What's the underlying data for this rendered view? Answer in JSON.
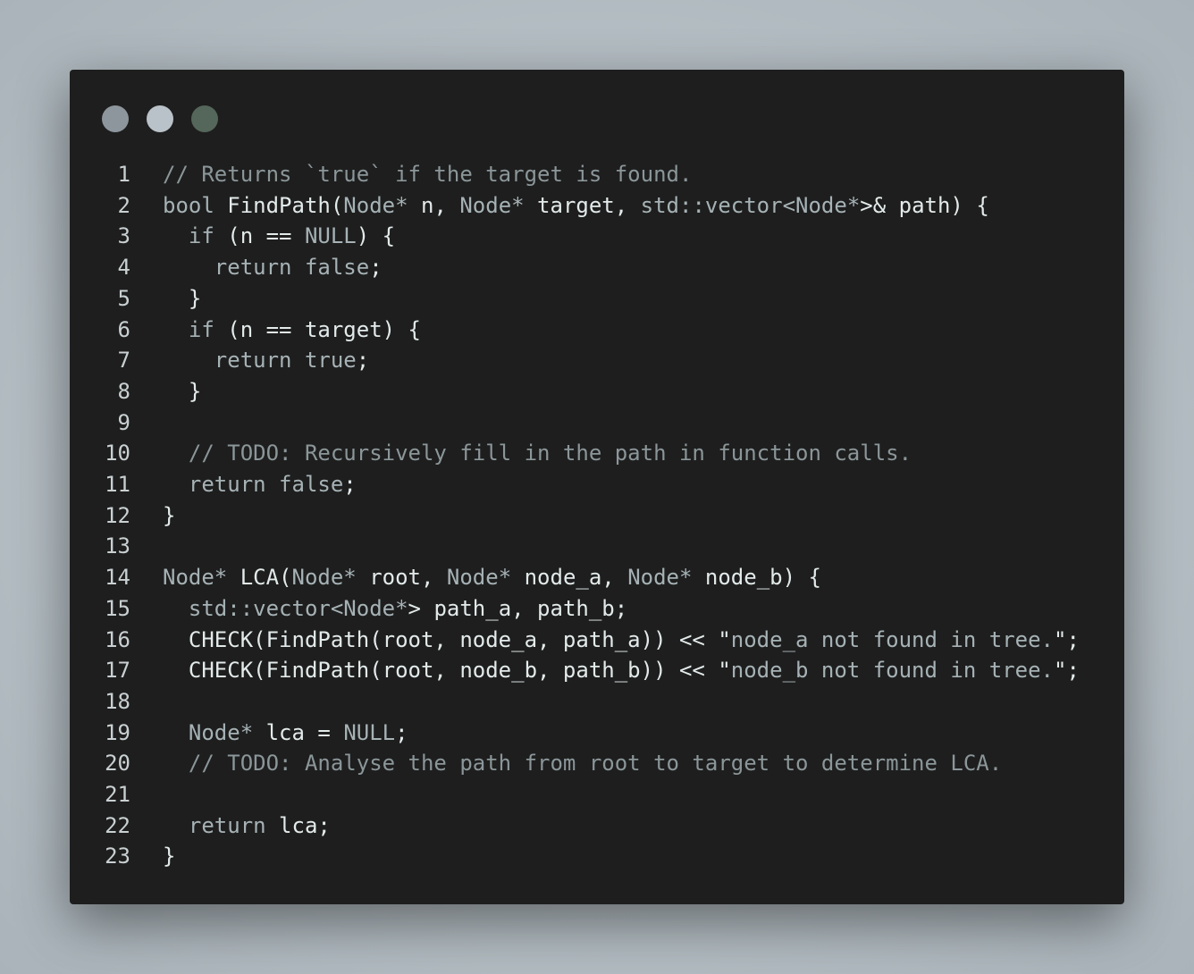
{
  "window_controls": [
    {
      "name": "close",
      "color": "#8d969c"
    },
    {
      "name": "minimize",
      "color": "#b9c2c8"
    },
    {
      "name": "maximize",
      "color": "#55665a"
    }
  ],
  "code_lines": [
    [
      [
        "// Returns `true` if the target is found.",
        "c"
      ]
    ],
    [
      [
        "bool ",
        "k"
      ],
      [
        "FindPath(",
        "i"
      ],
      [
        "Node*",
        "k"
      ],
      [
        " n, ",
        "i"
      ],
      [
        "Node*",
        "k"
      ],
      [
        " target, ",
        "i"
      ],
      [
        "std::vector<",
        "k"
      ],
      [
        "Node*",
        "k"
      ],
      [
        ">& path) {",
        "i"
      ]
    ],
    [
      [
        "  if",
        "k"
      ],
      [
        " (n == ",
        "i"
      ],
      [
        "NULL",
        "k"
      ],
      [
        ") {",
        "i"
      ]
    ],
    [
      [
        "    return false",
        "k"
      ],
      [
        ";",
        "i"
      ]
    ],
    [
      [
        "  }",
        "i"
      ]
    ],
    [
      [
        "  if",
        "k"
      ],
      [
        " (n == target) {",
        "i"
      ]
    ],
    [
      [
        "    return true",
        "k"
      ],
      [
        ";",
        "i"
      ]
    ],
    [
      [
        "  }",
        "i"
      ]
    ],
    [],
    [
      [
        "  // TODO: Recursively fill in the path in function calls.",
        "c"
      ]
    ],
    [
      [
        "  return false",
        "k"
      ],
      [
        ";",
        "i"
      ]
    ],
    [
      [
        "}",
        "i"
      ]
    ],
    [],
    [
      [
        "Node*",
        "k"
      ],
      [
        " LCA(",
        "i"
      ],
      [
        "Node*",
        "k"
      ],
      [
        " root, ",
        "i"
      ],
      [
        "Node*",
        "k"
      ],
      [
        " node_a, ",
        "i"
      ],
      [
        "Node*",
        "k"
      ],
      [
        " node_b) {",
        "i"
      ]
    ],
    [
      [
        "  std::vector<",
        "k"
      ],
      [
        "Node*",
        "k"
      ],
      [
        "> path_a, path_b;",
        "i"
      ]
    ],
    [
      [
        "  CHECK(FindPath(root, node_a, path_a)) << \"",
        "i"
      ],
      [
        "node_a not found in tree.",
        "k"
      ],
      [
        "\";",
        "i"
      ]
    ],
    [
      [
        "  CHECK(FindPath(root, node_b, path_b)) << \"",
        "i"
      ],
      [
        "node_b not found in tree.",
        "k"
      ],
      [
        "\";",
        "i"
      ]
    ],
    [],
    [
      [
        "  Node*",
        "k"
      ],
      [
        " lca = ",
        "i"
      ],
      [
        "NULL",
        "k"
      ],
      [
        ";",
        "i"
      ]
    ],
    [
      [
        "  // TODO: Analyse the path from root to target to determine LCA.",
        "c"
      ]
    ],
    [],
    [
      [
        "  return",
        "k"
      ],
      [
        " lca;",
        "i"
      ]
    ],
    [
      [
        "}",
        "i"
      ]
    ]
  ]
}
